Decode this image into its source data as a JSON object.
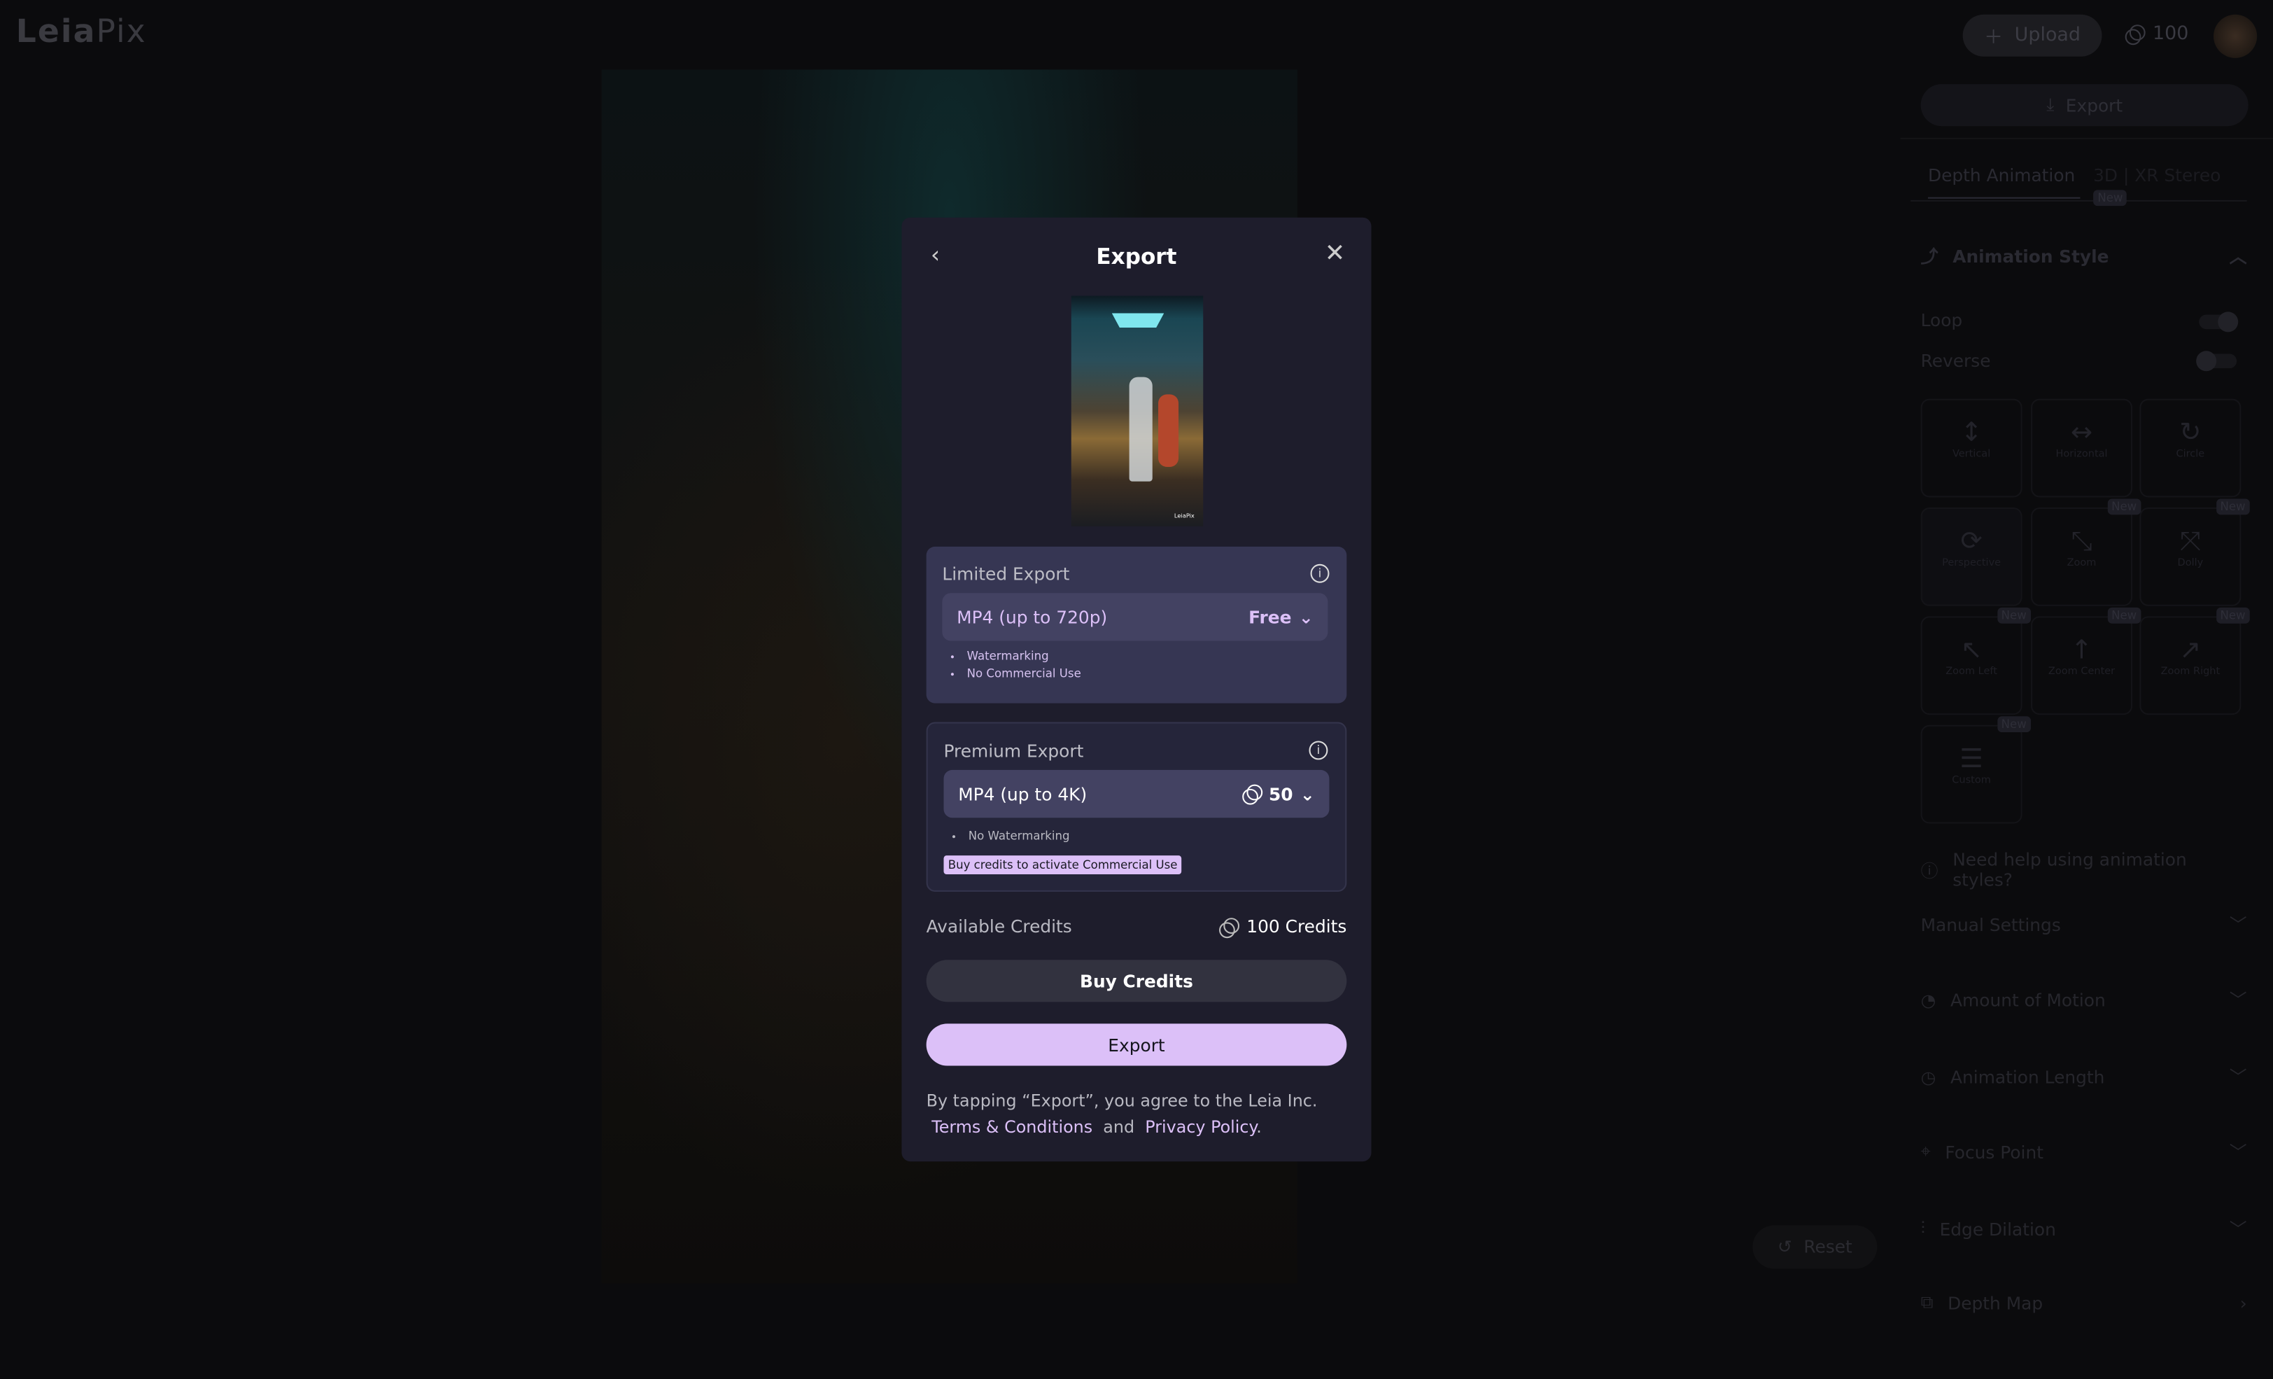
{
  "app": {
    "logo": "Leia",
    "logo_suffix": "Pix"
  },
  "header": {
    "upload_label": "Upload",
    "credits": "100"
  },
  "sidebar": {
    "export_label": "Export",
    "tabs": [
      {
        "label": "Depth Animation",
        "active": true
      },
      {
        "label": "3D | XR Stereo",
        "badge": "New"
      }
    ],
    "animation_style": {
      "title": "Animation Style",
      "loop_label": "Loop",
      "loop_on": true,
      "reverse_label": "Reverse",
      "reverse_on": false,
      "styles": [
        {
          "label": "Vertical",
          "icon": "vertical-arrows-icon"
        },
        {
          "label": "Horizontal",
          "icon": "horizontal-arrows-icon"
        },
        {
          "label": "Circle",
          "icon": "circle-arrow-icon"
        },
        {
          "label": "Perspective",
          "icon": "perspective-icon",
          "selected": true
        },
        {
          "label": "Zoom",
          "icon": "zoom-icon",
          "badge": "New"
        },
        {
          "label": "Dolly",
          "icon": "dolly-icon",
          "badge": "New"
        },
        {
          "label": "Zoom Left",
          "icon": "zoom-left-icon",
          "badge": "New"
        },
        {
          "label": "Zoom Center",
          "icon": "zoom-center-icon",
          "badge": "New"
        },
        {
          "label": "Zoom Right",
          "icon": "zoom-right-icon",
          "badge": "New"
        },
        {
          "label": "Custom",
          "icon": "sliders-icon",
          "badge": "New"
        }
      ],
      "help": "Need help using animation styles?"
    },
    "sections": [
      "Manual Settings",
      "Amount of Motion",
      "Animation Length",
      "Focus Point",
      "Edge Dilation",
      "Depth Map"
    ]
  },
  "reset_label": "Reset",
  "modal": {
    "title": "Export",
    "limited": {
      "title": "Limited Export",
      "format": "MP4 (up to 720p)",
      "price": "Free",
      "bullets": [
        "Watermarking",
        "No Commercial Use"
      ]
    },
    "premium": {
      "title": "Premium Export",
      "format": "MP4 (up to 4K)",
      "price": "50",
      "bullets": [
        "No Watermarking"
      ],
      "promo": "Buy credits to activate Commercial Use"
    },
    "available_label": "Available Credits",
    "available_value": "100 Credits",
    "buy_label": "Buy Credits",
    "export_label": "Export",
    "legal_text": "By tapping “Export”, you agree to the Leia Inc.",
    "terms": "Terms & Conditions",
    "and": "and",
    "privacy": "Privacy Policy",
    "period": ".",
    "thumb_watermark": "LeiaPix"
  },
  "colors": {
    "accent": "#dcc0f8",
    "modal_bg": "#1e1d2c",
    "card_limited": "#363653",
    "select_bg": "#434262"
  }
}
